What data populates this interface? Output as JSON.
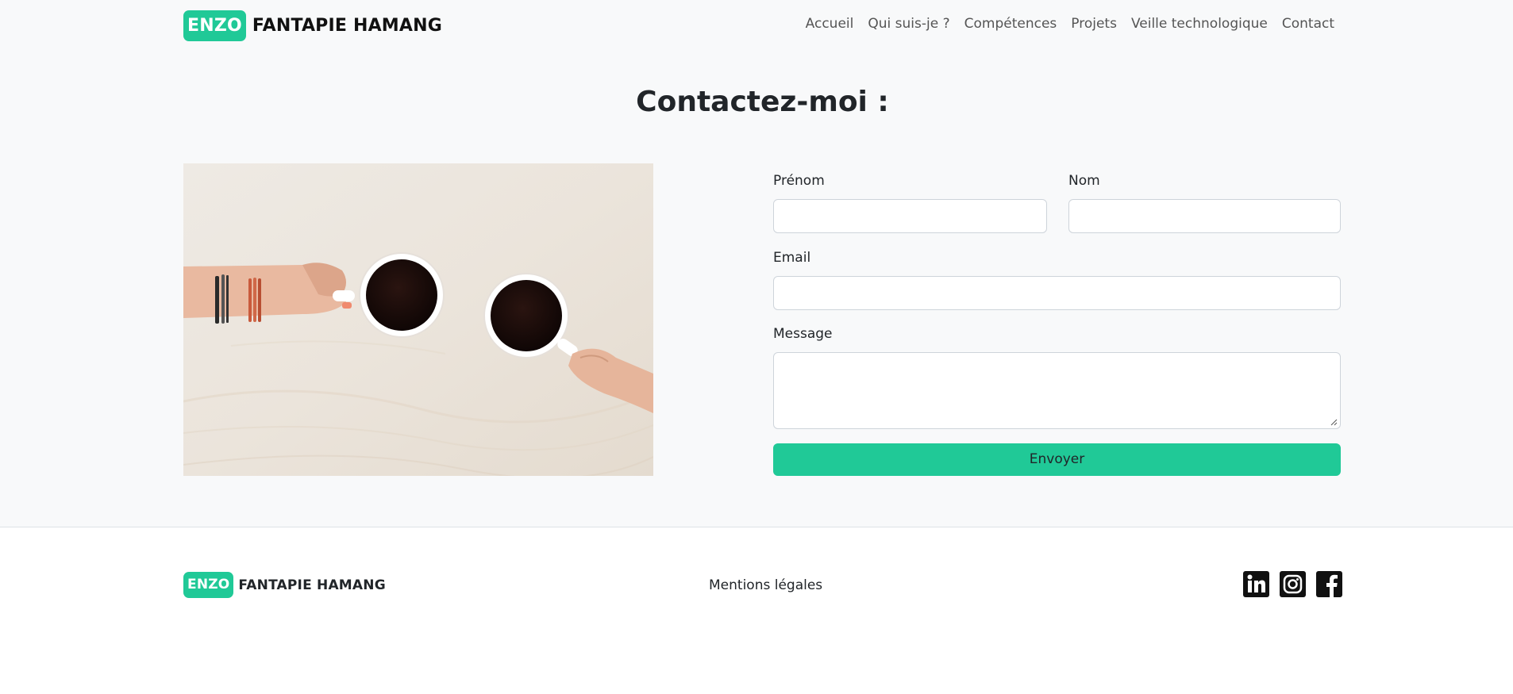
{
  "brand": {
    "badge": "ENZO",
    "name": "FANTAPIE HAMANG",
    "accent": "#20c997"
  },
  "nav": {
    "links": [
      {
        "label": "Accueil"
      },
      {
        "label": "Qui suis-je ?"
      },
      {
        "label": "Compétences"
      },
      {
        "label": "Projets"
      },
      {
        "label": "Veille technologique"
      },
      {
        "label": "Contact"
      }
    ]
  },
  "main": {
    "title": "Contactez-moi :",
    "image_icon": "coffee-cups-photo"
  },
  "form": {
    "first_name": {
      "label": "Prénom",
      "value": "",
      "placeholder": ""
    },
    "last_name": {
      "label": "Nom",
      "value": "",
      "placeholder": ""
    },
    "email": {
      "label": "Email",
      "value": "",
      "placeholder": ""
    },
    "message": {
      "label": "Message",
      "value": "",
      "placeholder": ""
    },
    "submit_label": "Envoyer"
  },
  "footer": {
    "legal_label": "Mentions légales",
    "socials": [
      {
        "icon": "linkedin-icon"
      },
      {
        "icon": "instagram-icon"
      },
      {
        "icon": "facebook-icon"
      }
    ]
  }
}
